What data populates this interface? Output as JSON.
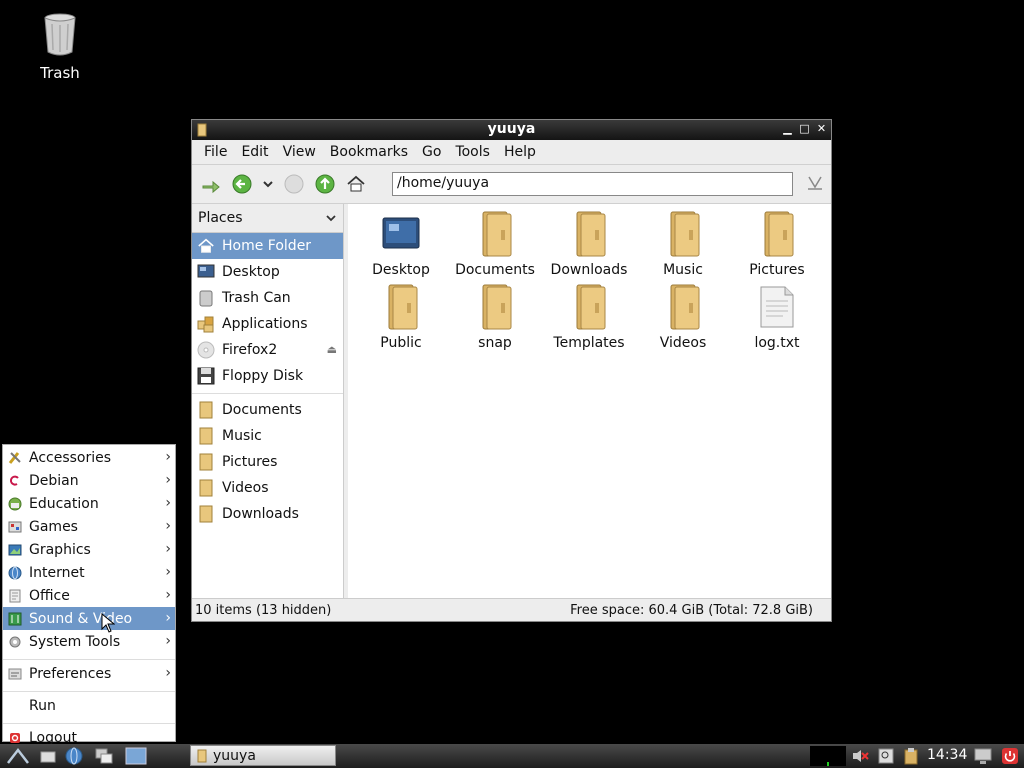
{
  "desktop": {
    "trash_label": "Trash"
  },
  "window": {
    "title": "yuuya",
    "menu": [
      "File",
      "Edit",
      "View",
      "Bookmarks",
      "Go",
      "Tools",
      "Help"
    ],
    "location": "/home/yuuya",
    "sidebar": {
      "header": "Places",
      "places": [
        "Home Folder",
        "Desktop",
        "Trash Can",
        "Applications",
        "Firefox2",
        "Floppy Disk"
      ],
      "bookmarks": [
        "Documents",
        "Music",
        "Pictures",
        "Videos",
        "Downloads"
      ]
    },
    "files": [
      "Desktop",
      "Documents",
      "Downloads",
      "Music",
      "Pictures",
      "Public",
      "snap",
      "Templates",
      "Videos",
      "log.txt"
    ],
    "status_left": "10 items (13 hidden)",
    "status_right": "Free space: 60.4 GiB (Total: 72.8 GiB)"
  },
  "startmenu": {
    "items": [
      "Accessories",
      "Debian",
      "Education",
      "Games",
      "Graphics",
      "Internet",
      "Office",
      "Sound & Video",
      "System Tools"
    ],
    "preferences": "Preferences",
    "run": "Run",
    "logout": "Logout"
  },
  "taskbar": {
    "task_label": "yuuya",
    "clock": "14:34"
  },
  "colors": {
    "selection": "#6e97c8",
    "folder": "#e8c77d"
  }
}
